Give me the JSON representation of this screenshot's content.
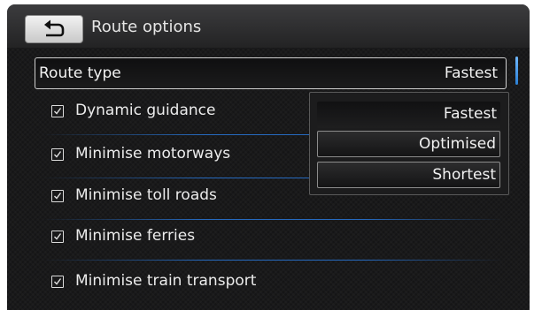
{
  "header": {
    "title": "Route options",
    "back_icon": "back-arrow-icon"
  },
  "route_type": {
    "label": "Route type",
    "value": "Fastest"
  },
  "options": [
    {
      "label": "Dynamic guidance",
      "checked": true
    },
    {
      "label": "Minimise motorways",
      "checked": true
    },
    {
      "label": "Minimise toll roads",
      "checked": true
    },
    {
      "label": "Minimise ferries",
      "checked": true
    },
    {
      "label": "Minimise train transport",
      "checked": true
    }
  ],
  "dropdown": {
    "items": [
      {
        "label": "Fastest",
        "selected": true
      },
      {
        "label": "Optimised",
        "selected": false
      },
      {
        "label": "Shortest",
        "selected": false
      }
    ]
  },
  "colors": {
    "accent_blue": "#2a7fd4",
    "background": "#151516",
    "text": "#ececec"
  }
}
